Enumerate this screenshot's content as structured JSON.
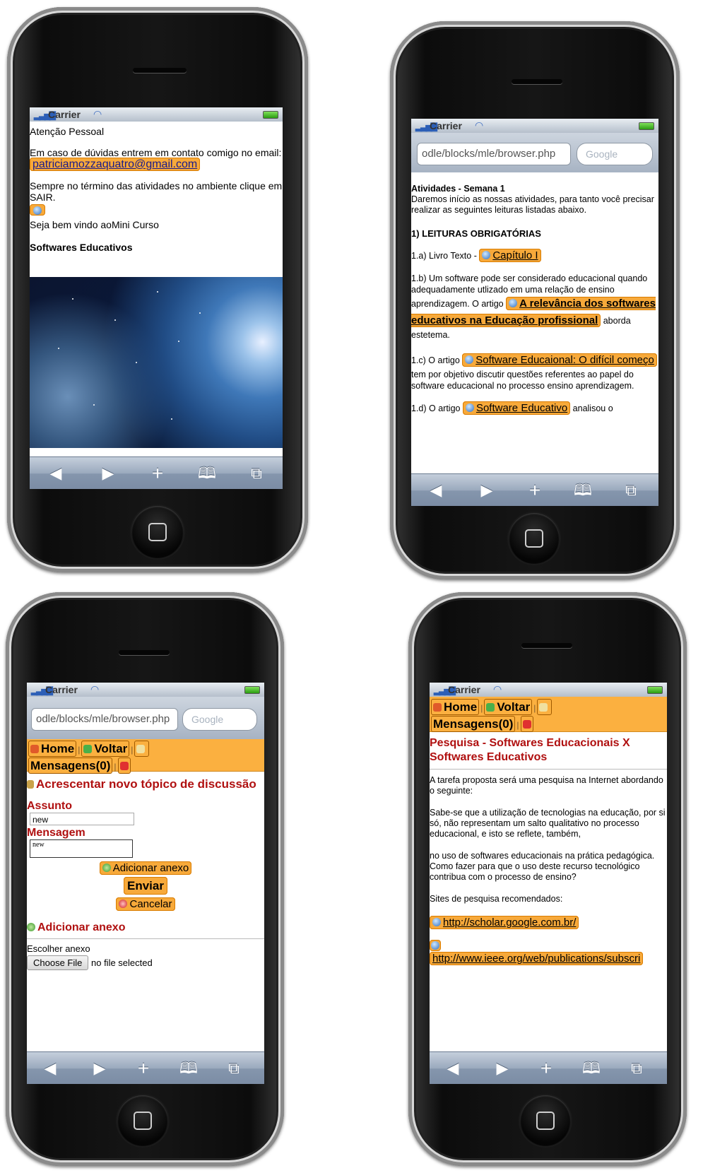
{
  "status": {
    "carrier": "Carrier"
  },
  "phone1": {
    "lines": {
      "heading": "Atenção Pessoal",
      "contact": "Em caso de dúvidas entrem em contato comigo no email:",
      "email": "patriciamozzaquatro@gmail.com",
      "exit": "Sempre no término das atividades no ambiente clique em SAIR.",
      "welcome": "Seja bem vindo aoMini Curso",
      "section": "Softwares Educativos"
    }
  },
  "phone2": {
    "url": "odle/blocks/mle/browser.php",
    "search_placeholder": "Google",
    "title": "Atividades - Semana 1",
    "intro": "Daremos início as nossas atividades, para tanto você precisar realizar as seguintes leituras listadas abaixo.",
    "section": "1) LEITURAS OBRIGATÓRIAS",
    "a_prefix": "1.a) Livro Texto - ",
    "a_link": "Capítulo I",
    "b_text": "1.b) Um software pode ser considerado educacional quando adequadamente utlizado em uma relação de ensino aprendizagem. O artigo",
    "b_link": "A relevância dos softwares educativos na Educação profissional",
    "b_suffix": " aborda estetema.",
    "c_prefix": "1.c) O artigo ",
    "c_link": "Software Educaional: O difícil começo",
    "c_suffix": " tem por objetivo discutir questões referentes ao papel do software educacional no processo ensino aprendizagem.",
    "d_prefix": "1.d) O artigo ",
    "d_link": "Software Educativo",
    "d_suffix": " analisou o"
  },
  "phone3": {
    "url": "odle/blocks/mle/browser.php",
    "search_placeholder": "Google",
    "nav": {
      "home": "Home",
      "back": "Voltar",
      "messages": "Mensagens(0)"
    },
    "heading": "Acrescentar novo tópico de discussão",
    "subject_label": "Assunto",
    "subject_value": "new",
    "message_label": "Mensagem",
    "message_value": "new",
    "add_attachment_btn": "Adicionar anexo",
    "send_btn": "Enviar",
    "cancel_btn": "Cancelar",
    "attach_section": "Adicionar anexo",
    "choose_label": "Escolher anexo",
    "choose_file_btn": "Choose File",
    "no_file": "no file selected"
  },
  "phone4": {
    "nav": {
      "home": "Home",
      "back": "Voltar",
      "messages": "Mensagens(0)"
    },
    "title": "Pesquisa - Softwares Educacionais X Softwares Educativos",
    "p1": "A tarefa proposta será uma pesquisa na Internet abordando o seguinte:",
    "p2": "Sabe-se que a utilização de tecnologias na educação, por si só, não representam um salto qualitativo no processo educacional, e isto se reflete, também,",
    "p3": "no uso de softwares educacionais na prática pedagógica. Como fazer para que o uso deste recurso tecnológico contribua com o processo de ensino?",
    "p4": "Sites de pesquisa recomendados:",
    "link1": "http://scholar.google.com.br/",
    "link2": "http://www.ieee.org/web/publications/subscri"
  }
}
